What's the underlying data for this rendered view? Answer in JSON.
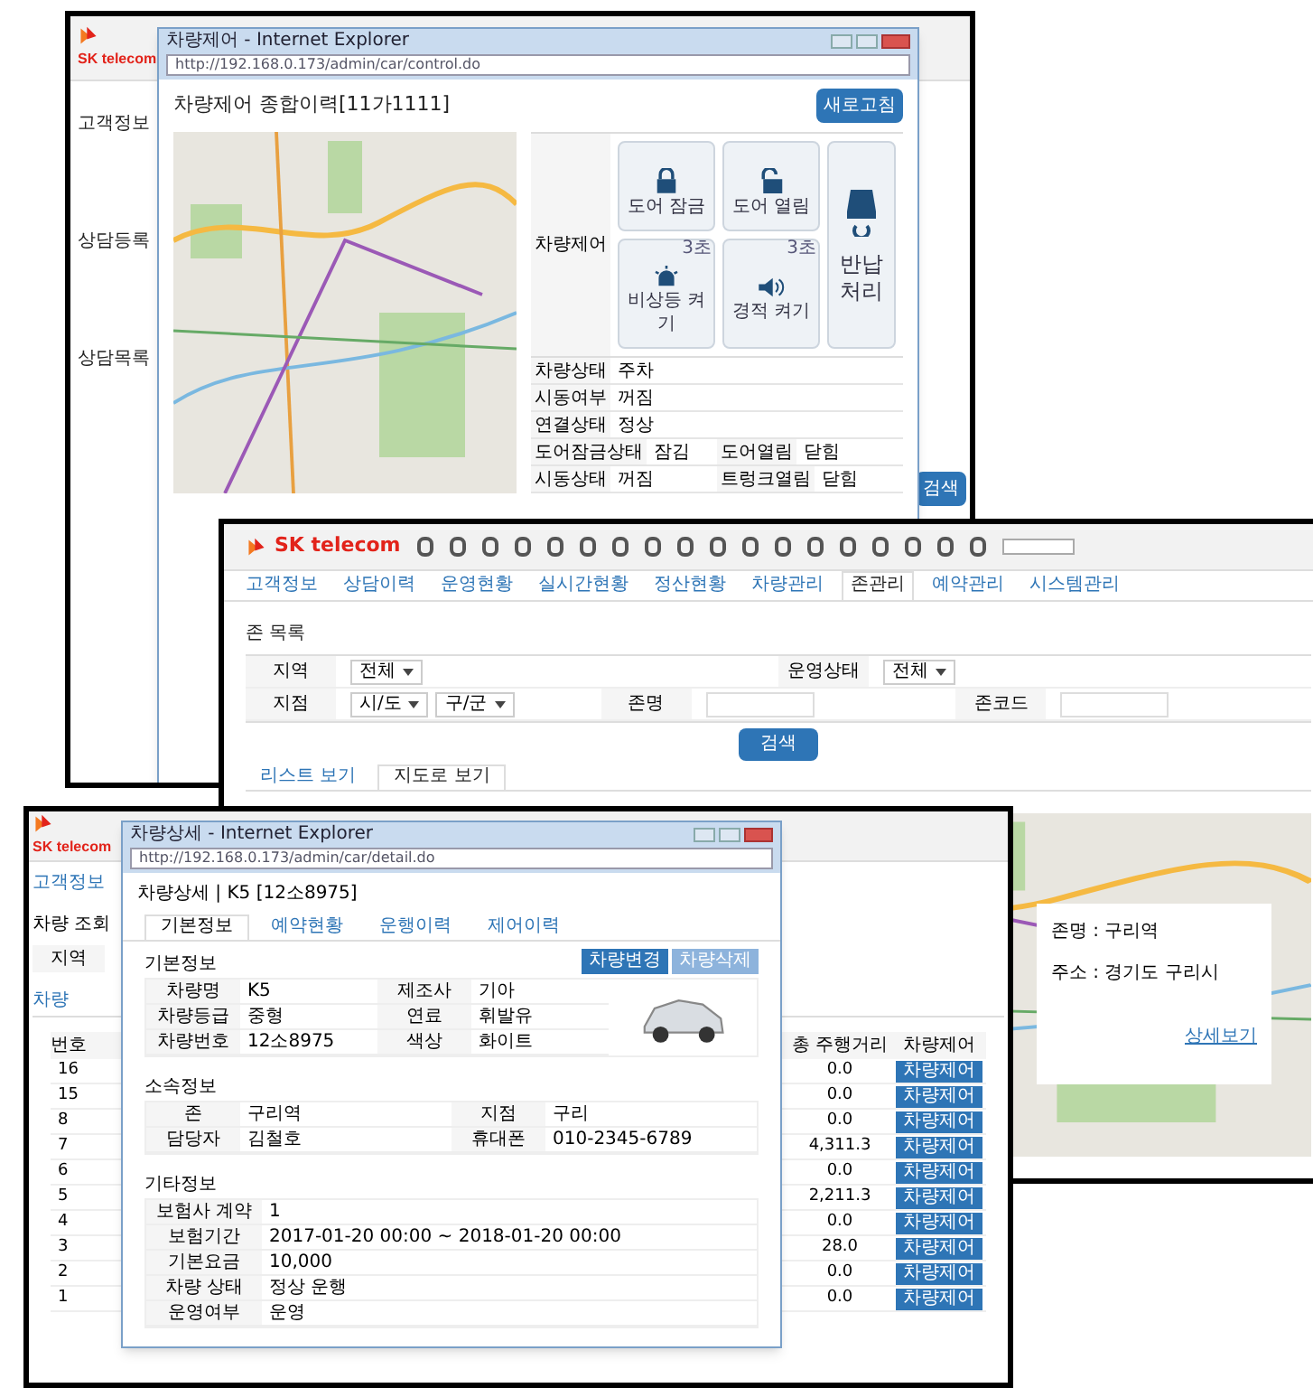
{
  "screen_a": {
    "logo": "SK telecom",
    "side_sections": [
      "고객정보",
      "상담등록",
      "상담목록"
    ],
    "side_button": "검색",
    "popup": {
      "browser_title": "차량제어 - Internet Explorer",
      "url": "http://192.168.0.173/admin/car/control.do",
      "title": "차량제어 종합이력[11가1111]",
      "refresh_button": "새로고침",
      "control_label": "차량제어",
      "controls": [
        {
          "label": "도어 잠금",
          "kind": "lock"
        },
        {
          "label": "도어 열림",
          "kind": "unlock"
        },
        {
          "label": "비상등 켜기",
          "kind": "siren",
          "badge": "3초"
        },
        {
          "label": "경적 켜기",
          "kind": "horn",
          "badge": "3초"
        }
      ],
      "return_button": "반납 처리",
      "info": [
        [
          [
            "차량상태",
            "주차"
          ]
        ],
        [
          [
            "시동여부",
            "꺼짐"
          ]
        ],
        [
          [
            "연결상태",
            "정상"
          ]
        ],
        [
          [
            "도어잠금상태",
            "잠김"
          ],
          [
            "도어열림",
            "닫힘"
          ]
        ],
        [
          [
            "시동상태",
            "꺼짐"
          ],
          [
            "트렁크열림",
            "닫힘"
          ]
        ]
      ]
    }
  },
  "screen_b": {
    "logo": "SK telecom",
    "tabs": [
      {
        "label": "고객정보",
        "selected": false
      },
      {
        "label": "상담이력",
        "selected": false
      },
      {
        "label": "운영현황",
        "selected": false
      },
      {
        "label": "실시간현황",
        "selected": false
      },
      {
        "label": "정산현황",
        "selected": false
      },
      {
        "label": "차량관리",
        "selected": false
      },
      {
        "label": "존관리",
        "selected": true
      },
      {
        "label": "예약관리",
        "selected": false
      },
      {
        "label": "시스템관리",
        "selected": false
      }
    ],
    "section": "존 목록",
    "filters": [
      [
        {
          "label": "지역",
          "kind": "select",
          "value": "전체"
        },
        {
          "label": "운영상태",
          "kind": "select",
          "value": "전체"
        }
      ],
      [
        {
          "label": "지점",
          "kind": "select",
          "value": "시/도",
          "value_2": "구/군"
        },
        {
          "label": "존명",
          "kind": "input"
        },
        {
          "label": "존코드",
          "kind": "input"
        }
      ]
    ],
    "search_button": "검색",
    "views": [
      {
        "label": "리스트 보기",
        "selected": false
      },
      {
        "label": "지도로 보기",
        "selected": true
      }
    ],
    "map_popup": {
      "title": "존명 : 구리역",
      "line": "주소 : 경기도 구리시",
      "link": "상세보기"
    }
  },
  "screen_c": {
    "logo": "SK telecom",
    "nav_tab": "고객정보",
    "section": "차량 조회",
    "filter_label": "지역",
    "list_tab": "차량",
    "columns": [
      "번호",
      "총 주행거리",
      "차량제어"
    ],
    "rows": [
      [
        "16",
        "0.0",
        "차량제어"
      ],
      [
        "15",
        "0.0",
        "차량제어"
      ],
      [
        "8",
        "0.0",
        "차량제어"
      ],
      [
        "7",
        "4,311.3",
        "차량제어"
      ],
      [
        "6",
        "0.0",
        "차량제어"
      ],
      [
        "5",
        "2,211.3",
        "차량제어"
      ],
      [
        "4",
        "0.0",
        "차량제어"
      ],
      [
        "3",
        "28.0",
        "차량제어"
      ],
      [
        "2",
        "0.0",
        "차량제어"
      ],
      [
        "1",
        "0.0",
        "차량제어"
      ]
    ],
    "popup": {
      "browser_title": "차량상세 - Internet Explorer",
      "url": "http://192.168.0.173/admin/car/detail.do",
      "title": "차량상세 | K5 [12소8975]",
      "tabs": [
        {
          "label": "기본정보",
          "selected": true
        },
        {
          "label": "예약현황",
          "selected": false
        },
        {
          "label": "운행이력",
          "selected": false
        },
        {
          "label": "제어이력",
          "selected": false
        }
      ],
      "basic_title": "기본정보",
      "buttons": [
        "차량변경",
        "차량삭제"
      ],
      "basic": [
        [
          [
            "차량명",
            "K5"
          ],
          [
            "제조사",
            "기아"
          ]
        ],
        [
          [
            "차량등급",
            "중형"
          ],
          [
            "연료",
            "휘발유"
          ]
        ],
        [
          [
            "차량번호",
            "12소8975"
          ],
          [
            "색상",
            "화이트"
          ]
        ]
      ],
      "org_title": "소속정보",
      "org": [
        [
          [
            "존",
            "구리역"
          ],
          [
            "지점",
            "구리"
          ]
        ],
        [
          [
            "담당자",
            "김철호"
          ],
          [
            "휴대폰",
            "010-2345-6789"
          ]
        ]
      ],
      "etc_title": "기타정보",
      "etc": [
        [
          "보험사 계약",
          "1"
        ],
        [
          "보험기간",
          "2017-01-20 00:00 ~ 2018-01-20 00:00"
        ],
        [
          "기본요금",
          "10,000"
        ],
        [
          "차량 상태",
          "정상 운행"
        ],
        [
          "운영여부",
          "운영"
        ]
      ]
    }
  }
}
